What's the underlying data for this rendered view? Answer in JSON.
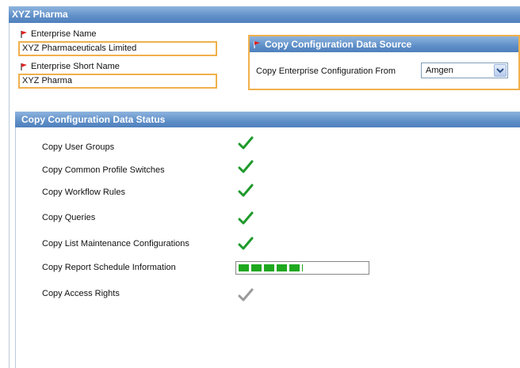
{
  "title": "XYZ Pharma",
  "enterprise_name": {
    "label": "Enterprise Name",
    "value": "XYZ Pharmaceuticals Limited"
  },
  "enterprise_short_name": {
    "label": "Enterprise Short Name",
    "value": "XYZ Pharma"
  },
  "copy_source": {
    "header": "Copy Configuration Data Source",
    "label": "Copy Enterprise Configuration From",
    "selected": "Amgen"
  },
  "status": {
    "header": "Copy Configuration Data Status",
    "items": [
      {
        "label": "Copy User Groups",
        "state": "complete"
      },
      {
        "label": "Copy Common Profile Switches",
        "state": "complete"
      },
      {
        "label": "Copy Workflow Rules",
        "state": "complete"
      },
      {
        "label": "Copy Queries",
        "state": "complete"
      },
      {
        "label": "Copy List Maintenance Configurations",
        "state": "complete"
      },
      {
        "label": "Copy Report Schedule Information",
        "state": "in-progress",
        "progress": 0.5
      },
      {
        "label": "Copy Access Rights",
        "state": "pending"
      }
    ]
  },
  "colors": {
    "header_blue": "#5f8fc8",
    "field_border": "#f0b04c",
    "check_green": "#1f9a2c",
    "check_gray": "#9a9a9a",
    "progress_green": "#1ea81e"
  }
}
